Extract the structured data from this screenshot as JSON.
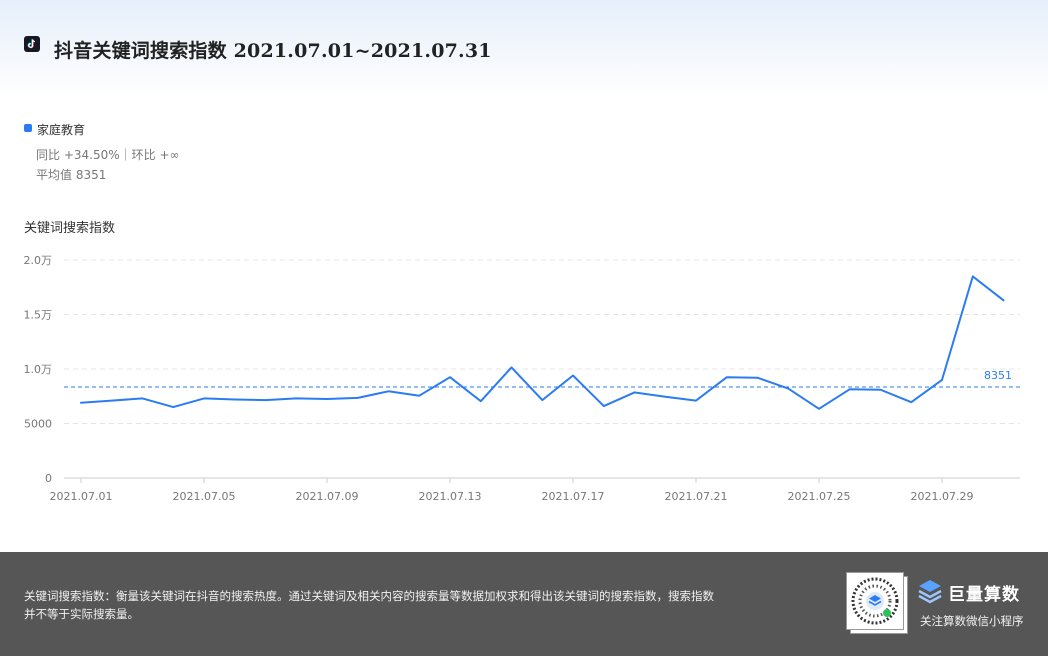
{
  "header": {
    "title": "抖音关键词搜索指数 2021.07.01~2021.07.31",
    "app_icon": "tiktok-icon"
  },
  "legend": {
    "series_name": "家庭教育",
    "yoy_mom": "同比 +34.50%｜环比 +∞",
    "average": "平均值 8351"
  },
  "chart_title": "关键词搜索指数",
  "colors": {
    "line": "#2b7cf2",
    "grid": "#e4e4e4",
    "axis_text": "#777777",
    "footer_bg": "#565656"
  },
  "chart_data": {
    "type": "line",
    "title": "关键词搜索指数",
    "x": [
      "2021.07.01",
      "2021.07.02",
      "2021.07.03",
      "2021.07.04",
      "2021.07.05",
      "2021.07.06",
      "2021.07.07",
      "2021.07.08",
      "2021.07.09",
      "2021.07.10",
      "2021.07.11",
      "2021.07.12",
      "2021.07.13",
      "2021.07.14",
      "2021.07.15",
      "2021.07.16",
      "2021.07.17",
      "2021.07.18",
      "2021.07.19",
      "2021.07.20",
      "2021.07.21",
      "2021.07.22",
      "2021.07.23",
      "2021.07.24",
      "2021.07.25",
      "2021.07.26",
      "2021.07.27",
      "2021.07.28",
      "2021.07.29",
      "2021.07.30",
      "2021.07.31"
    ],
    "x_tick_labels": [
      "2021.07.01",
      "2021.07.05",
      "2021.07.09",
      "2021.07.13",
      "2021.07.17",
      "2021.07.21",
      "2021.07.25",
      "2021.07.29"
    ],
    "series": [
      {
        "name": "家庭教育",
        "values": [
          6900,
          7100,
          7300,
          6500,
          7300,
          7200,
          7150,
          7300,
          7250,
          7350,
          7950,
          7550,
          9250,
          7050,
          10150,
          7150,
          9400,
          6600,
          7850,
          7450,
          7100,
          9250,
          9200,
          8200,
          6350,
          8150,
          8100,
          6950,
          9000,
          18500,
          16300
        ]
      }
    ],
    "average": 8351,
    "average_label": "8351",
    "ylim": [
      0,
      20000
    ],
    "y_ticks": [
      0,
      5000,
      10000,
      15000,
      20000
    ],
    "y_tick_labels": [
      "0",
      "5000",
      "1.0万",
      "1.5万",
      "2.0万"
    ],
    "grid": "horizontal-dashed",
    "legend": "top-left"
  },
  "footer": {
    "description_line1": "关键词搜索指数：衡量该关键词在抖音的搜索热度。通过关键词及相关内容的搜索量等数据加权求和得出该关键词的搜索指数，搜索指数",
    "description_line2": "并不等于实际搜索量。",
    "brand_name": "巨量算数",
    "brand_icon": "juliang-logo-icon",
    "qr_icon": "qr-code-icon",
    "brand_sub": "关注算数微信小程序"
  }
}
